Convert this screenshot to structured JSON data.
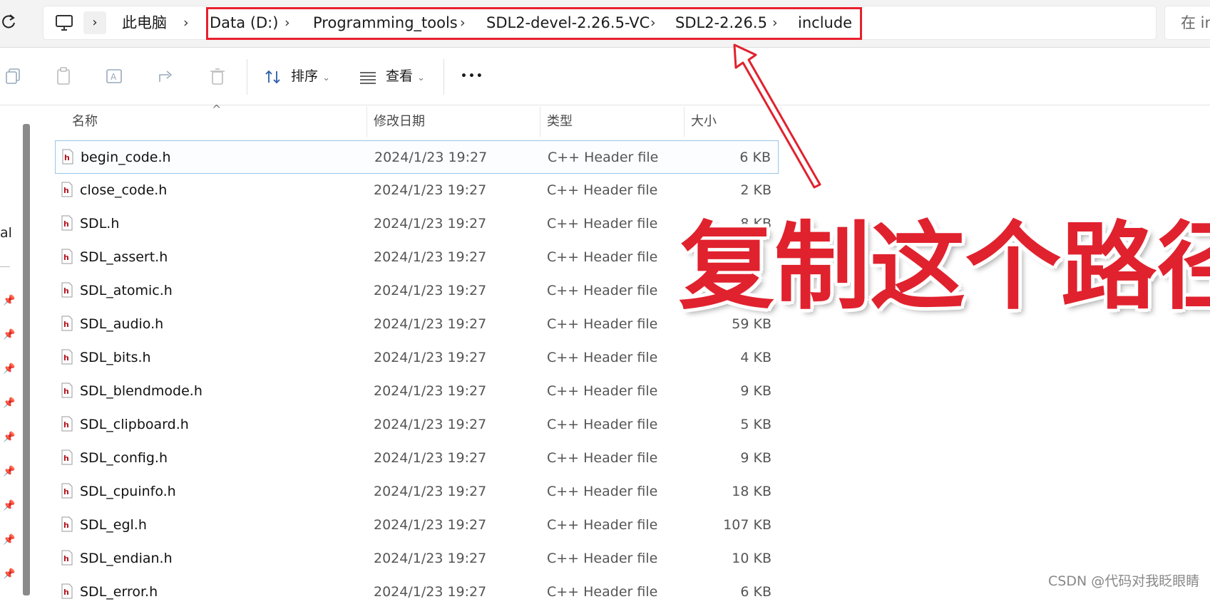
{
  "address": {
    "crumbs": [
      "此电脑",
      "Data (D:)",
      "Programming_tools",
      "SDL2-devel-2.26.5-VC",
      "SDL2-2.26.5",
      "include"
    ],
    "search_placeholder": "在 in"
  },
  "toolbar": {
    "sort_label": "排序",
    "view_label": "查看",
    "more_label": "•••"
  },
  "leftpane": {
    "partial_text": "al"
  },
  "columns": {
    "name": "名称",
    "date": "修改日期",
    "type": "类型",
    "size": "大小"
  },
  "files": [
    {
      "name": "begin_code.h",
      "date": "2024/1/23 19:27",
      "type": "C++ Header file",
      "size": "6 KB"
    },
    {
      "name": "close_code.h",
      "date": "2024/1/23 19:27",
      "type": "C++ Header file",
      "size": "2 KB"
    },
    {
      "name": "SDL.h",
      "date": "2024/1/23 19:27",
      "type": "C++ Header file",
      "size": "8 KB"
    },
    {
      "name": "SDL_assert.h",
      "date": "2024/1/23 19:27",
      "type": "C++ Header file",
      "size": ""
    },
    {
      "name": "SDL_atomic.h",
      "date": "2024/1/23 19:27",
      "type": "C++ Header file",
      "size": ""
    },
    {
      "name": "SDL_audio.h",
      "date": "2024/1/23 19:27",
      "type": "C++ Header file",
      "size": "59 KB"
    },
    {
      "name": "SDL_bits.h",
      "date": "2024/1/23 19:27",
      "type": "C++ Header file",
      "size": "4 KB"
    },
    {
      "name": "SDL_blendmode.h",
      "date": "2024/1/23 19:27",
      "type": "C++ Header file",
      "size": "9 KB"
    },
    {
      "name": "SDL_clipboard.h",
      "date": "2024/1/23 19:27",
      "type": "C++ Header file",
      "size": "5 KB"
    },
    {
      "name": "SDL_config.h",
      "date": "2024/1/23 19:27",
      "type": "C++ Header file",
      "size": "9 KB"
    },
    {
      "name": "SDL_cpuinfo.h",
      "date": "2024/1/23 19:27",
      "type": "C++ Header file",
      "size": "18 KB"
    },
    {
      "name": "SDL_egl.h",
      "date": "2024/1/23 19:27",
      "type": "C++ Header file",
      "size": "107 KB"
    },
    {
      "name": "SDL_endian.h",
      "date": "2024/1/23 19:27",
      "type": "C++ Header file",
      "size": "10 KB"
    },
    {
      "name": "SDL_error.h",
      "date": "2024/1/23 19:27",
      "type": "C++ Header file",
      "size": "6 KB"
    }
  ],
  "annotation": {
    "text": "复制这个路径",
    "color": "#e0222e"
  },
  "watermark": "CSDN @代码对我眨眼睛"
}
